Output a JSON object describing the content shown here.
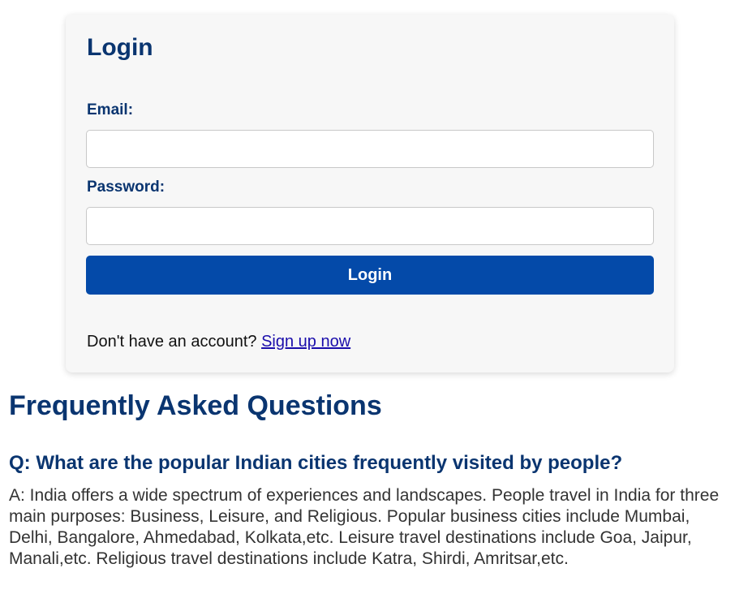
{
  "login": {
    "title": "Login",
    "email_label": "Email:",
    "email_value": "",
    "email_placeholder": "",
    "password_label": "Password:",
    "password_value": "",
    "password_placeholder": "",
    "button_label": "Login",
    "signup_prompt": "Don't have an account? ",
    "signup_link": "Sign up now"
  },
  "faq": {
    "title": "Frequently Asked Questions",
    "items": [
      {
        "question": "Q: What are the popular Indian cities frequently visited by people?",
        "answer": "A: India offers a wide spectrum of experiences and landscapes. People travel in India for three main purposes: Business, Leisure, and Religious. Popular business cities include Mumbai, Delhi, Bangalore, Ahmedabad, Kolkata,etc. Leisure travel destinations include Goa, Jaipur, Manali,etc. Religious travel destinations include Katra, Shirdi, Amritsar,etc."
      }
    ]
  },
  "colors": {
    "heading": "#0a3570",
    "button": "#044aa9",
    "link": "#1a0dab",
    "card_bg": "#f7f7f7"
  }
}
